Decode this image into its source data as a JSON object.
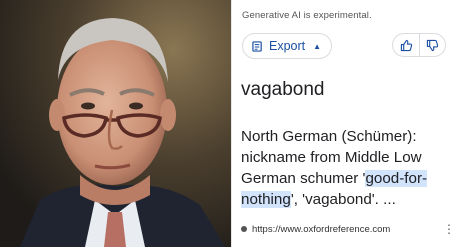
{
  "photo": {
    "subject": "portrait-photo"
  },
  "header": {
    "notice": "Generative AI is experimental."
  },
  "toolbar": {
    "export_label": "Export",
    "export_chevron": "▲"
  },
  "result": {
    "word": "vagabond",
    "definition_before": "North German (Schümer): nickname from Middle Low German schumer '",
    "definition_highlight": "good-for-nothing",
    "definition_after": "', 'vagabond'. ...",
    "source_url": "https://www.oxfordreference.com",
    "more_glyph": "⋮"
  },
  "colors": {
    "accent": "#1a4fa3",
    "highlight": "#d2e3fc",
    "text": "#202124"
  }
}
